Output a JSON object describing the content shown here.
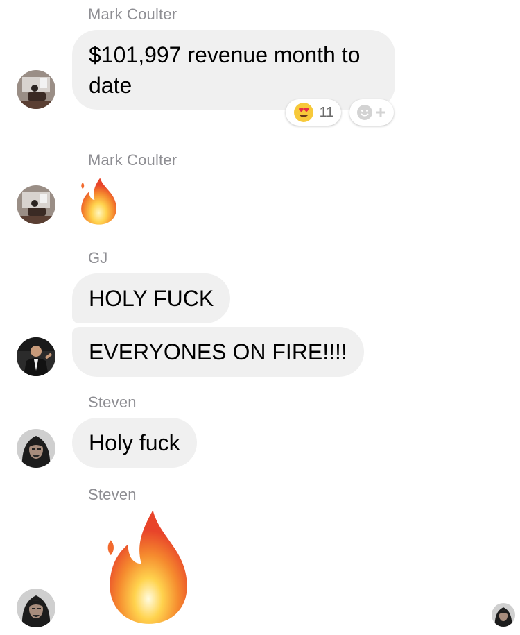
{
  "messages": [
    {
      "sender": "Mark Coulter",
      "text": "$101,997 revenue month to date",
      "reactions": {
        "emoji": "heart-eyes",
        "count": "11"
      }
    },
    {
      "sender": "Mark Coulter",
      "emoji": "fire",
      "size": "small"
    },
    {
      "sender": "GJ",
      "lines": [
        "HOLY FUCK",
        "EVERYONES ON FIRE!!!!"
      ]
    },
    {
      "sender": "Steven",
      "text": "Holy fuck"
    },
    {
      "sender": "Steven",
      "emoji": "fire",
      "size": "large"
    }
  ],
  "colors": {
    "bubble": "#f0f0f0",
    "sender_label": "#8e8e93",
    "fire_outer": "#e8442a",
    "fire_inner": "#ffd34e"
  }
}
